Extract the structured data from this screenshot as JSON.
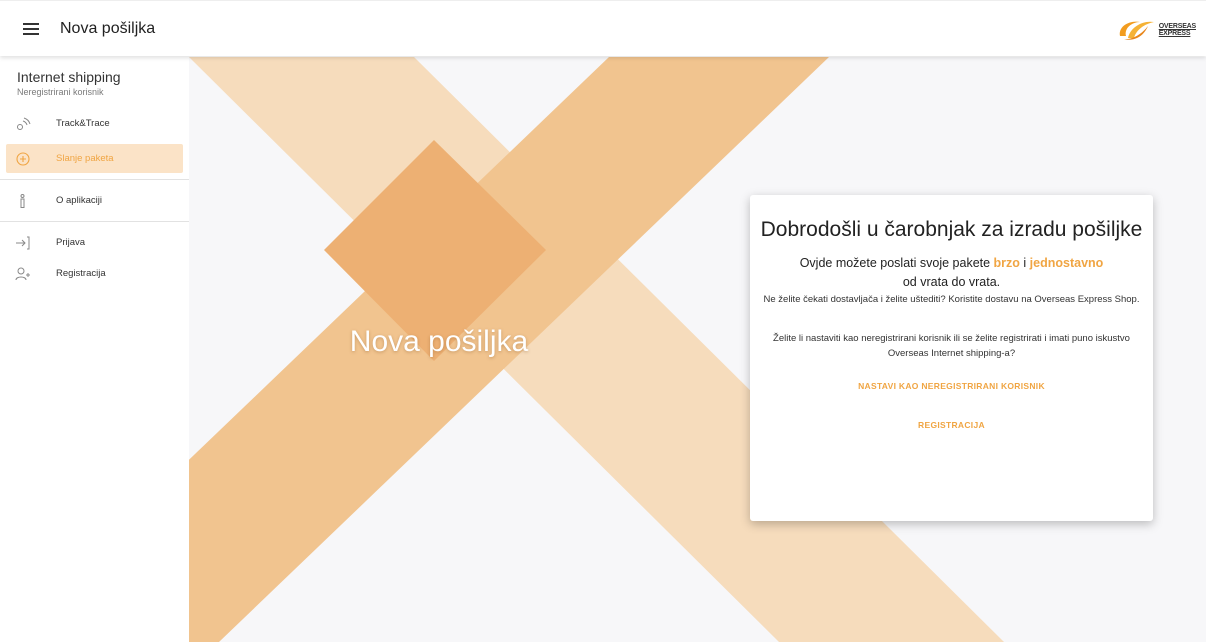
{
  "header": {
    "title": "Nova pošiljka",
    "logo_line1": "OVERSEAS",
    "logo_line2": "EXPRESS"
  },
  "sidebar": {
    "title": "Internet shipping",
    "subtitle": "Neregistrirani korisnik",
    "items": [
      {
        "label": "Track&Trace",
        "icon": "track-trace-icon"
      },
      {
        "label": "Slanje paketa",
        "icon": "add-circle-icon",
        "active": true
      },
      {
        "label": "O aplikaciji",
        "icon": "info-icon"
      },
      {
        "label": "Prijava",
        "icon": "login-icon"
      },
      {
        "label": "Registracija",
        "icon": "add-user-icon"
      }
    ]
  },
  "hero": {
    "title": "Nova pošiljka"
  },
  "card": {
    "title": "Dobrodošli u čarobnjak za izradu pošiljke",
    "lead_pre": "Ovjde možete poslati svoje pakete ",
    "lead_hl1": "brzo",
    "lead_mid": " i ",
    "lead_hl2": "jednostavno",
    "lead_post": "od vrata do vrata.",
    "small": "Ne želite čekati dostavljača i želite uštediti? Koristite dostavu na Overseas Express Shop.",
    "question": "Želite li nastaviti kao neregistrirani korisnik ili se želite registrirati i imati puno iskustvo Overseas Internet shipping-a?",
    "continue_label": "NASTAVI KAO NEREGISTRIRANI KORISNIK",
    "register_label": "REGISTRACIJA"
  },
  "colors": {
    "accent": "#f0a543",
    "band_light": "#f6dcbc",
    "band_mid": "#f1c48f",
    "band_overlap": "#edb073",
    "active_bg": "#fbe3c7"
  }
}
